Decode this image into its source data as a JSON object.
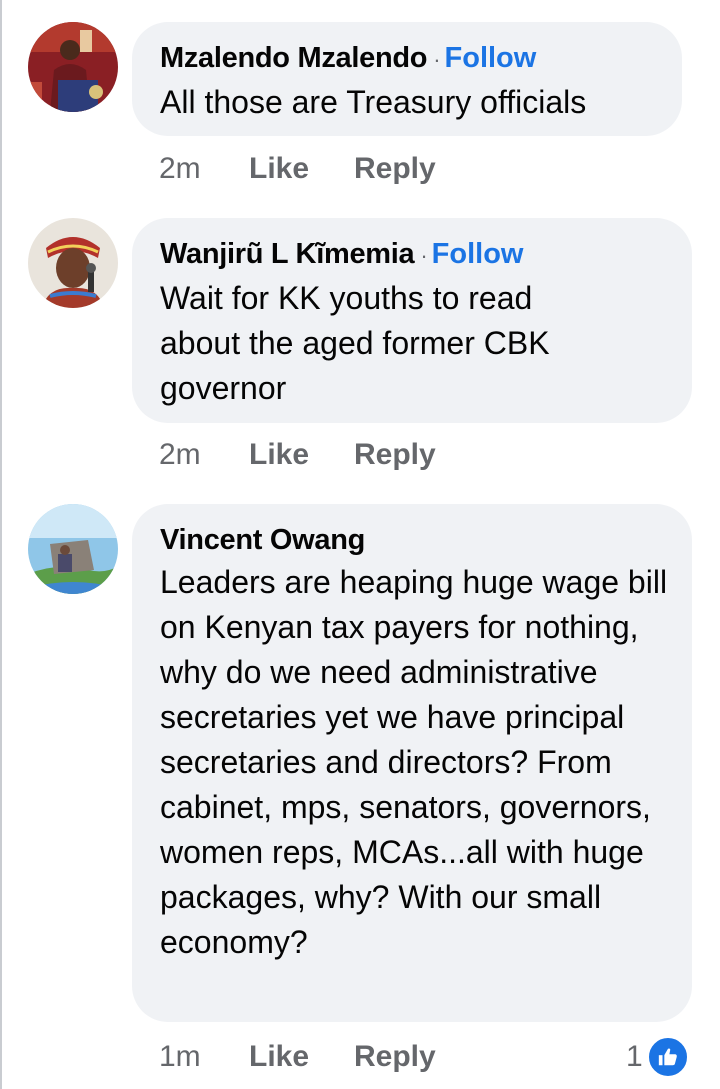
{
  "comments": [
    {
      "author": "Mzalendo Mzalendo",
      "follow_label": "Follow",
      "separator": "·",
      "text": "All those are Treasury officials",
      "time": "2m",
      "like_label": "Like",
      "reply_label": "Reply",
      "avatar_icon": "profile-photo-speaker-at-podium"
    },
    {
      "author": "Wanjirũ L Kĩmemia",
      "follow_label": "Follow",
      "separator": "·",
      "text": "Wait for KK youths to read about the aged former CBK governor",
      "time": "2m",
      "like_label": "Like",
      "reply_label": "Reply",
      "avatar_icon": "profile-photo-woman-with-microphone"
    },
    {
      "author": "Vincent Owang",
      "text": "Leaders are heaping huge wage bill on Kenyan tax payers for nothing, why do we need administrative secretaries yet we have principal secretaries and directors? From cabinet, mps, senators, governors, women reps, MCAs...all with huge packages, why? With our small economy?",
      "time": "1m",
      "like_label": "Like",
      "reply_label": "Reply",
      "reaction_count": "1",
      "reaction_icon": "thumbs-up-icon",
      "avatar_icon": "profile-photo-outdoor-scene"
    }
  ],
  "colors": {
    "bubble_bg": "#f0f2f5",
    "follow_blue": "#1b74e4",
    "meta_gray": "#65676b"
  }
}
